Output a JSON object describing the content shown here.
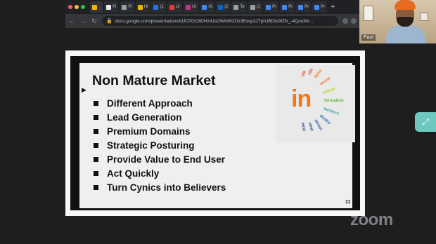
{
  "browser": {
    "tabs": [
      {
        "label": "",
        "color": "#f4b400"
      },
      {
        "label": "Pi",
        "color": "#e8eaed"
      },
      {
        "label": "Pi",
        "color": "#9aa0a6"
      },
      {
        "label": "Hi",
        "color": "#f4b400"
      },
      {
        "label": "(1",
        "color": "#1877f2"
      },
      {
        "label": "Ur",
        "color": "#e53935"
      },
      {
        "label": "Ur",
        "color": "#c13584"
      },
      {
        "label": "Hi",
        "color": "#4285f4"
      },
      {
        "label": "(2",
        "color": "#0a66c2"
      },
      {
        "label": "Te",
        "color": "#9aa0a6"
      },
      {
        "label": "(1",
        "color": "#9aa0a6"
      },
      {
        "label": "Pr",
        "color": "#4285f4"
      },
      {
        "label": "Pr",
        "color": "#4285f4"
      },
      {
        "label": "Pr",
        "color": "#4285f4"
      },
      {
        "label": "Pr",
        "color": "#4285f4"
      }
    ],
    "new_tab_label": "+",
    "back_icon": "arrow-left-icon",
    "url": "docs.google.com/presentation/d/1fO7OC8DHz4JsOWNW2Oz3Exvp3JTphJBDto3fZN_-4Q/edit#..."
  },
  "participant": {
    "name": "Paul"
  },
  "slide": {
    "title": "Non Mature Market",
    "bullets": [
      "Different Approach",
      "Lead Generation",
      "Premium Domains",
      "Strategic Posturing",
      "Provide Value to End User",
      "Act Quickly",
      "Turn Cynics into Believers"
    ],
    "page_number": "11",
    "logo_text": "in",
    "cloud_words": [
      {
        "text": "dle",
        "color": "#e8452c"
      },
      {
        "text": "vile",
        "color": "#e8452c"
      },
      {
        "text": "apire",
        "color": "#f07a1a"
      },
      {
        "text": "terest",
        "color": "#f07a1a"
      },
      {
        "text": "stitute",
        "color": "#c5d12a"
      },
      {
        "text": "formation",
        "color": "#6cb33f"
      },
      {
        "text": "surance",
        "color": "#2aa198"
      },
      {
        "text": "dustry",
        "color": "#1e6fb0"
      },
      {
        "text": "struct",
        "color": "#1e4fa0"
      },
      {
        "text": "vest",
        "color": "#1e3f90"
      },
      {
        "text": "vest",
        "color": "#1e3f90"
      }
    ]
  },
  "controls": {
    "expand_icon": "expand-arrows-icon"
  },
  "watermark": {
    "text": "zoom"
  }
}
